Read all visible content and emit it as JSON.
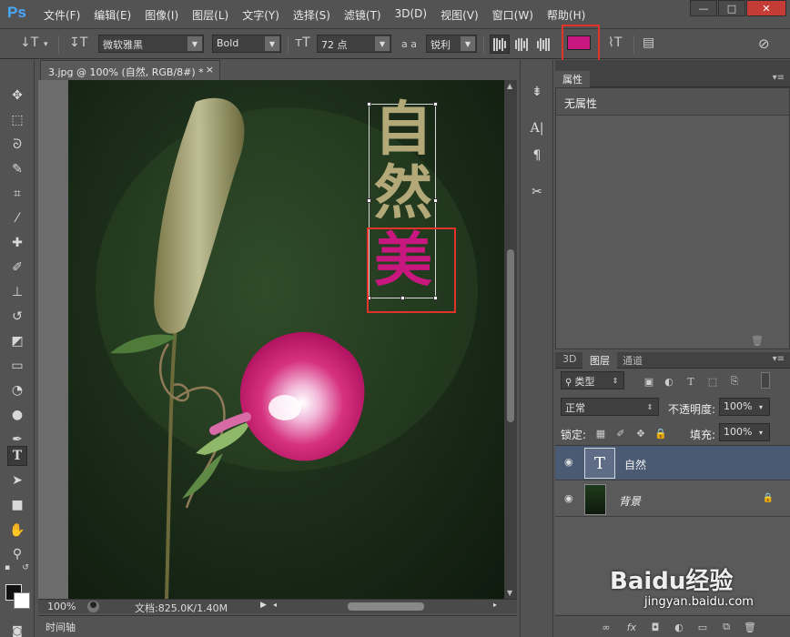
{
  "app": {
    "logo": "Ps"
  },
  "menu": [
    "文件(F)",
    "编辑(E)",
    "图像(I)",
    "图层(L)",
    "文字(Y)",
    "选择(S)",
    "滤镜(T)",
    "3D(D)",
    "视图(V)",
    "窗口(W)",
    "帮助(H)"
  ],
  "window_controls": {
    "minimize": "—",
    "maximize": "□",
    "close": "✕"
  },
  "options": {
    "font_family": "微软雅黑",
    "font_style": "Bold",
    "font_size": "72 点",
    "aa_label": "a a",
    "antialias": "锐利",
    "text_color": "#c8187f"
  },
  "document": {
    "tab_title": "3.jpg @ 100% (自然, RGB/8#) *",
    "close": "×",
    "text_chars": [
      "自",
      "然",
      "美"
    ],
    "text_colors": {
      "primary": "#b3a878",
      "highlight": "#c8187f"
    }
  },
  "status": {
    "zoom": "100%",
    "doc": "文档:825.0K/1.40M"
  },
  "timeline": {
    "label": "时间轴"
  },
  "properties": {
    "tab": "属性",
    "content": "无属性"
  },
  "layers_panel": {
    "tabs": [
      "3D",
      "图层",
      "通道"
    ],
    "filter": "类型",
    "blend_mode": "正常",
    "opacity_label": "不透明度:",
    "opacity": "100%",
    "lock_label": "锁定:",
    "fill_label": "填充:",
    "fill": "100%",
    "layers": [
      {
        "name": "自然",
        "type": "text",
        "thumb": "T",
        "selected": true
      },
      {
        "name": "背景",
        "type": "image",
        "selected": false
      }
    ]
  },
  "watermark": {
    "brand": "Baidu经验",
    "url": "jingyan.baidu.com"
  }
}
